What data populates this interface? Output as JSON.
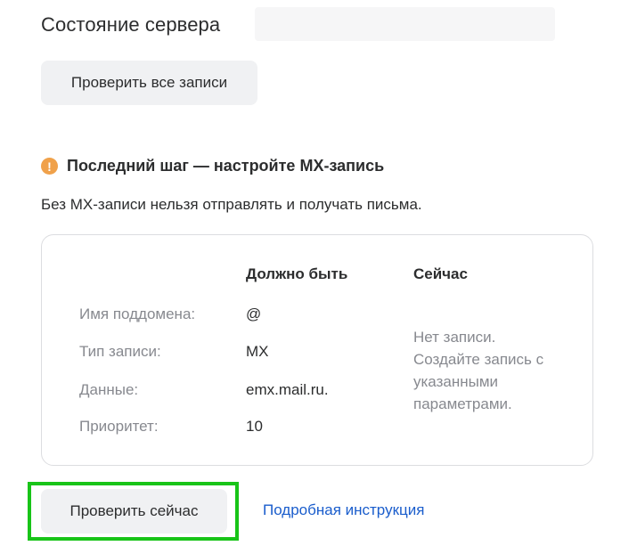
{
  "header": {
    "title": "Состояние сервера"
  },
  "actions": {
    "check_all_label": "Проверить все записи",
    "check_now_label": "Проверить сейчас",
    "instructions_link": "Подробная инструкция"
  },
  "warning": {
    "icon": "exclamation-icon",
    "icon_glyph": "!",
    "icon_color": "#f0a14a",
    "title": "Последний шаг — настройте MX-запись",
    "description": "Без MX-записи нельзя отправлять и получать письма."
  },
  "record_table": {
    "columns": {
      "expected": "Должно быть",
      "current": "Сейчас"
    },
    "rows": [
      {
        "label": "Имя поддомена:",
        "value": "@"
      },
      {
        "label": "Тип записи:",
        "value": "MX"
      },
      {
        "label": "Данные:",
        "value": "emx.mail.ru."
      },
      {
        "label": "Приоритет:",
        "value": "10"
      }
    ],
    "current_status": "Нет записи. Создайте запись с указанными параметрами."
  },
  "theme": {
    "highlight_color": "#18c418",
    "link_color": "#1a5dcc"
  }
}
